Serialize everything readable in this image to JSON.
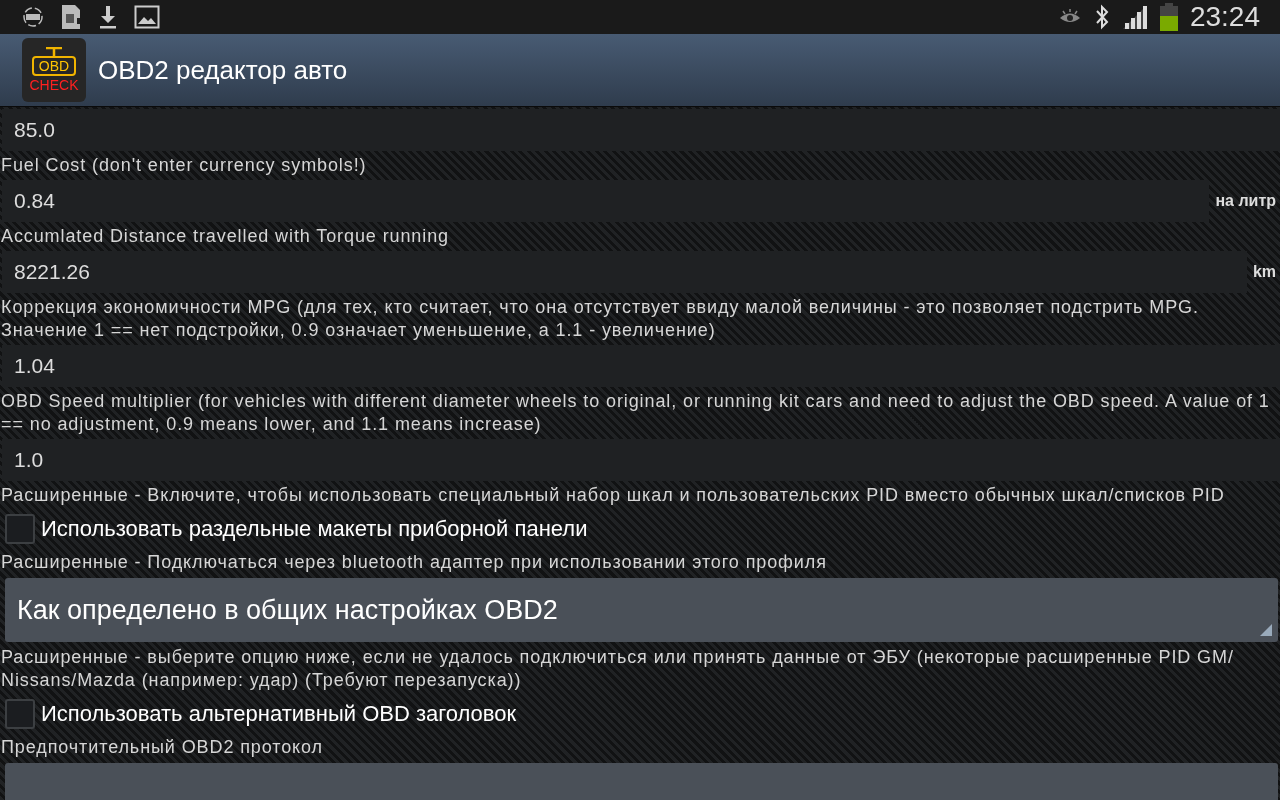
{
  "status_bar": {
    "time": "23:24"
  },
  "action_bar": {
    "title": "OBD2 редактор авто",
    "logo": {
      "top": "OBD",
      "bottom": "CHECK"
    }
  },
  "items": [
    {
      "kind": "field",
      "value": "85.0"
    },
    {
      "kind": "label",
      "text": "Fuel Cost (don't enter currency symbols!)"
    },
    {
      "kind": "field",
      "value": "0.84",
      "unit": "на литр"
    },
    {
      "kind": "label",
      "text": "Accumlated Distance travelled with Torque running"
    },
    {
      "kind": "field",
      "value": "8221.26",
      "unit": "km"
    },
    {
      "kind": "label",
      "text": "Коррекция экономичности MPG (для тех, кто считает, что она отсутствует ввиду малой величины - это позволяет подстрить MPG. Значение 1 == нет подстройки, 0.9 означает уменьшение, а 1.1 - увеличение)"
    },
    {
      "kind": "field",
      "value": "1.04"
    },
    {
      "kind": "label",
      "text": "OBD Speed multiplier (for vehicles with different diameter wheels to original, or running kit cars and need to adjust the OBD speed. A value of 1 == no adjustment, 0.9 means lower, and 1.1 means increase)"
    },
    {
      "kind": "field",
      "value": "1.0"
    },
    {
      "kind": "label",
      "text": "Расширенные - Включите, чтобы использовать специальный набор шкал и пользовательских PID вместо обычных шкал/списков PID"
    },
    {
      "kind": "checkbox",
      "text": "Использовать раздельные макеты приборной панели",
      "checked": false
    },
    {
      "kind": "label",
      "text": "Расширенные - Подключаться через bluetooth адаптер при использовании этого профиля"
    },
    {
      "kind": "dropdown",
      "value": "Как определено в общих настройках OBD2"
    },
    {
      "kind": "label",
      "text": "Расширенные - выберите опцию ниже, если не удалось подключиться или принять данные от ЭБУ (некоторые расширенные PID GM/ Nissans/Mazda (например: удар) (Требуют перезапуска))"
    },
    {
      "kind": "checkbox",
      "text": "Использовать альтернативный OBD заголовок",
      "checked": false
    },
    {
      "kind": "label",
      "text": "Предпочтительный OBD2 протокол"
    },
    {
      "kind": "dropdown"
    }
  ]
}
